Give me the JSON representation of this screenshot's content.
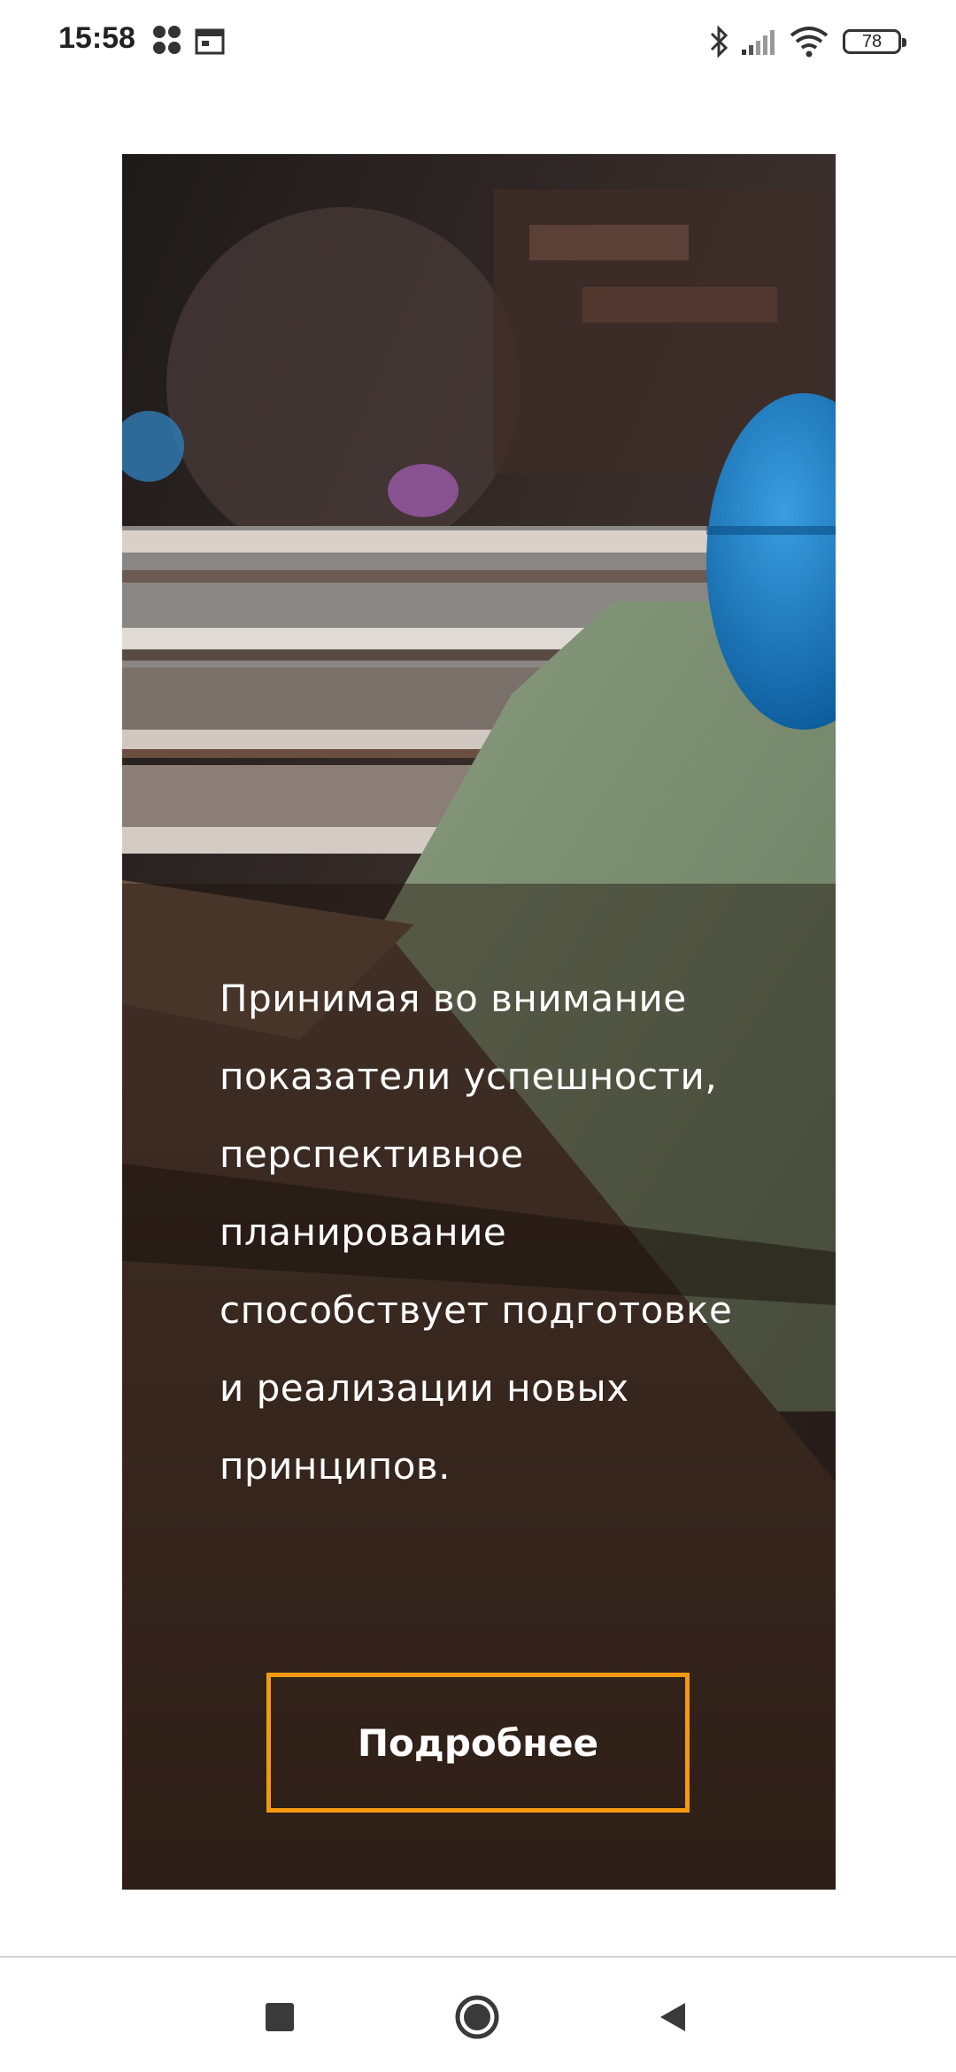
{
  "status_bar": {
    "time": "15:58",
    "battery_level": "78",
    "icons": [
      "notification-dots-icon",
      "calendar-icon",
      "bluetooth-icon",
      "signal-icon",
      "wifi-icon",
      "battery-icon"
    ]
  },
  "card": {
    "image_description_name": "construction-photo",
    "text": "Принимая во внимание показатели успешности, перспективное планирование способствует подготовке и реализации новых принципов.",
    "button_label": "Подробнее",
    "accent_color": "#f39a12"
  },
  "nav_bar": {
    "buttons": [
      "recent-apps-icon",
      "home-icon",
      "back-icon"
    ]
  }
}
